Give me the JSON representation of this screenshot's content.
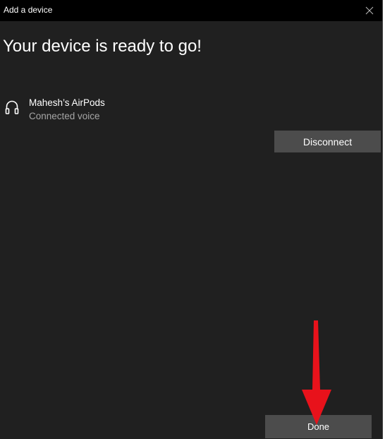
{
  "window": {
    "title": "Add a device",
    "close_icon": "close-icon"
  },
  "main": {
    "heading": "Your device is ready to go!"
  },
  "device": {
    "icon": "headphones-icon",
    "name": "Mahesh’s AirPods",
    "status": "Connected voice",
    "disconnect_label": "Disconnect"
  },
  "footer": {
    "done_label": "Done"
  },
  "annotation": {
    "arrow_icon": "red-arrow-down-icon",
    "arrow_color": "#e8121b"
  },
  "colors": {
    "window_bg": "#202020",
    "titlebar_bg": "#000000",
    "button_bg": "#4c4c4c",
    "secondary_text": "#a6a6a6"
  }
}
